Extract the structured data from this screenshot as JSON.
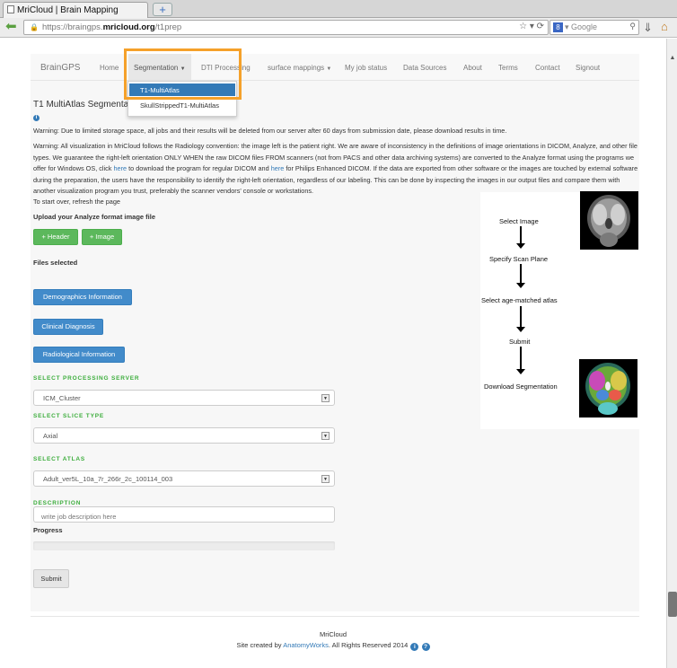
{
  "browser": {
    "tab_title": "MriCloud | Brain Mapping",
    "url_prefix": "https://braingps.",
    "url_domain": "mricloud.org",
    "url_path": "/t1prep",
    "search_placeholder": "Google"
  },
  "nav": {
    "brand": "BrainGPS",
    "home": "Home",
    "segmentation": "Segmentation",
    "dti": "DTI Processing",
    "surface": "surface mappings",
    "jobs": "My job status",
    "data_sources": "Data Sources",
    "about": "About",
    "terms": "Terms",
    "contact": "Contact",
    "signout": "Signout"
  },
  "dropdown": {
    "item1": "T1-MultiAtlas",
    "item2": "SkullStrippedT1-MultiAtlas"
  },
  "main": {
    "title": "T1 MultiAtlas Segmentation",
    "warning1": "Warning: Due to limited storage space, all jobs and their results will be deleted from our server after 60 days from submission date, please download results in time.",
    "warning2_part1": "Warning: All visualization in MriCloud follows the Radiology convention: the image left is the patient right. We are aware of inconsistency in the definitions of image orientations in DICOM, Analyze, and other file types. We guarantee the right-left orientation ONLY WHEN the raw DICOM files FROM scanners (not from PACS and other data archiving systems) are converted to the Analyze format using the programs we offer for Windows OS, click ",
    "warning2_link1": "here",
    "warning2_part2": " to download the program for regular DICOM and ",
    "warning2_link2": "here",
    "warning2_part3": " for Philips Enhanced DICOM. If the data are exported from other software or the images are touched by external software during the preparation, the users have the responsibility to identify the right-left orientation, regardless of our labeling. This can be done by inspecting the images in our output files and compare them with another visualization program you trust, preferably the scanner vendors' console or workstations.",
    "restart_text": "To start over, refresh the page",
    "upload_label": "Upload your Analyze format image file",
    "header_button": "+ Header",
    "image_button": "+ Image",
    "files_selected": "Files selected",
    "demographics_button": "Demographics Information",
    "clinical_button": "Clinical Diagnosis",
    "radiological_button": "Radiological Information",
    "server_label": "SELECT PROCESSING SERVER",
    "server_value": "ICM_Cluster",
    "slice_label": "SELECT SLICE TYPE",
    "slice_value": "Axial",
    "atlas_label": "SELECT ATLAS",
    "atlas_value": "Adult_ver5L_10a_7r_266r_2c_100114_003",
    "description_label": "DESCRIPTION",
    "description_placeholder": "write job description here",
    "progress_label": "Progress",
    "progress_fraction": 0,
    "submit_button": "Submit"
  },
  "flow": {
    "step1": "Select Image",
    "step2": "Specify Scan Plane",
    "step3": "Select age-matched atlas",
    "step4": "Submit",
    "step5": "Download Segmentation"
  },
  "footer": {
    "site_name": "MriCloud",
    "credit_prefix": "Site created by ",
    "credit_link": "AnatomyWorks",
    "credit_suffix": ". All Rights Reserved 2014"
  },
  "colors": {
    "highlight": "#f5a12a",
    "primary": "#337ab7",
    "success": "#5cb85c",
    "label_green": "#3dae3d"
  },
  "icons": {
    "info": "info-icon",
    "help": "help-icon",
    "back": "back-arrow-icon",
    "lock": "lock-icon",
    "download": "download-icon",
    "home": "home-icon"
  }
}
